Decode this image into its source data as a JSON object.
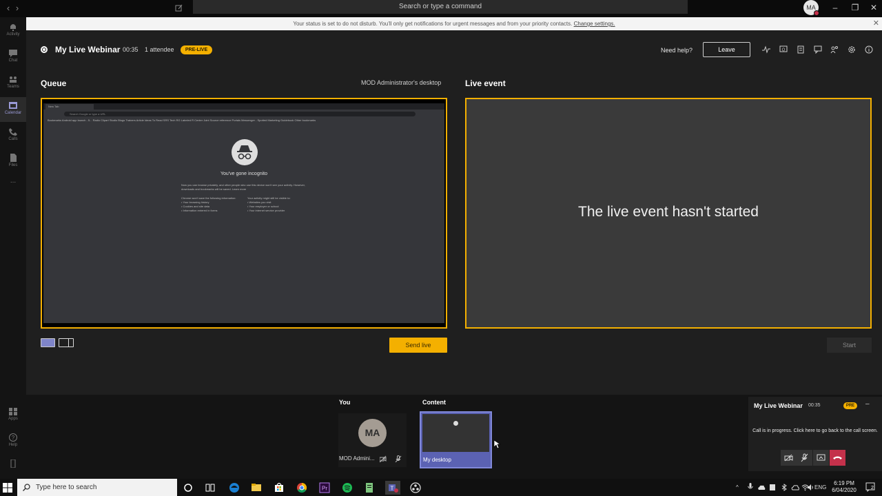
{
  "titlebar": {
    "search_placeholder": "Search or type a command",
    "avatar_initials": "MA"
  },
  "rail": {
    "items": [
      {
        "label": "Activity"
      },
      {
        "label": "Chat"
      },
      {
        "label": "Teams"
      },
      {
        "label": "Calendar"
      },
      {
        "label": "Calls"
      },
      {
        "label": "Files"
      },
      {
        "label": "Apps"
      },
      {
        "label": "Help"
      }
    ],
    "more": "..."
  },
  "notification": {
    "text": "Your status is set to do not disturb. You'll only get notifications for urgent messages and from your priority contacts. ",
    "link": "Change settings."
  },
  "meeting": {
    "title": "My Live Webinar",
    "timer": "00:35",
    "attendees": "1 attendee",
    "badge": "PRE-LIVE",
    "need_help": "Need help?",
    "leave": "Leave"
  },
  "queue": {
    "label": "Queue",
    "source": "MOD Administrator's desktop",
    "send_live": "Send live",
    "browser": {
      "tab": "New Tab",
      "url": "Search Google or type a URL",
      "bookmarks": "Bookmarks   Android app launch - 5...   Radio   Clipart Studio   Blogs   Trainers   Article Ideas   To Read   SRS Tech   RG Labeled   R Center   Joint Source reference   Portals   Messenger - Spotted   Marketing Guidebook   Other bookmarks",
      "title": "You've gone incognito",
      "desc": "Now you can browse privately, and other people who use this device won't see your activity. However, downloads and bookmarks will be saved. Learn more",
      "col1": "Chrome won't save the following information:\n• Your browsing history\n• Cookies and site data\n• Information entered in forms",
      "col2": "Your activity might still be visible to:\n• Websites you visit\n• Your employer or school\n• Your internet service provider"
    }
  },
  "live": {
    "label": "Live event",
    "message": "The live event hasn't started",
    "start": "Start"
  },
  "strip": {
    "you_label": "You",
    "content_label": "Content",
    "you_initials": "MA",
    "you_name": "MOD Admini...",
    "content_name": "My desktop"
  },
  "mini": {
    "title": "My Live Webinar",
    "timer": "00:35",
    "badge": "PRE",
    "message": "Call is in progress. Click here to go back to the call screen."
  },
  "taskbar": {
    "search_placeholder": "Type here to search",
    "lang": "ENG",
    "time": "6:19 PM",
    "date": "6/04/2020",
    "notif_count": "2"
  },
  "colors": {
    "accent": "#f4b000",
    "teams_purple": "#5b62b3",
    "hangup": "#c4314b"
  }
}
